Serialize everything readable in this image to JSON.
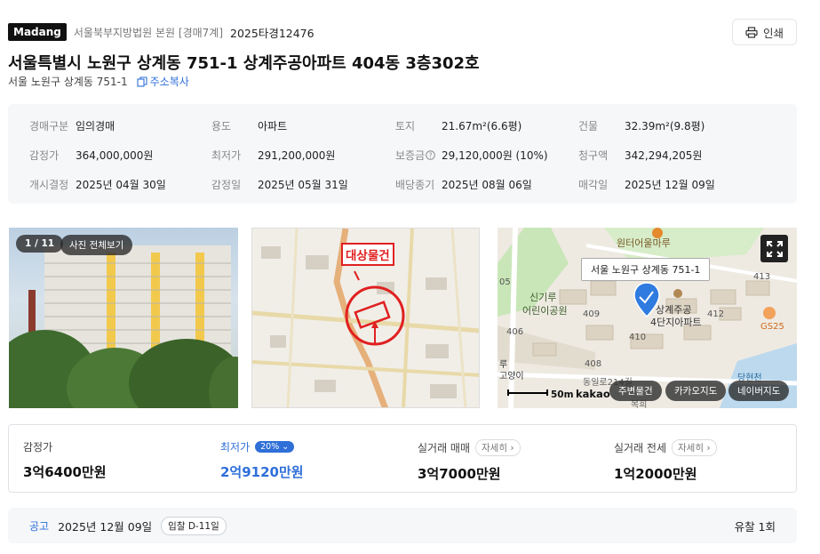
{
  "header": {
    "brand": "Madang",
    "court": "서울북부지방법원 본원 [경매7계]",
    "case_number": "2025타경12476",
    "print_label": "인쇄"
  },
  "property": {
    "title": "서울특별시 노원구 상계동 751-1 상계주공아파트 404동 3층302호",
    "address": "서울 노원구 상계동 751-1",
    "copy_label": "주소복사"
  },
  "info": [
    {
      "key": "경매구분",
      "value": "임의경매"
    },
    {
      "key": "용도",
      "value": "아파트"
    },
    {
      "key": "토지",
      "value": "21.67m²(6.6평)"
    },
    {
      "key": "건물",
      "value": "32.39m²(9.8평)"
    },
    {
      "key": "감정가",
      "value": "364,000,000원"
    },
    {
      "key": "최저가",
      "value": "291,200,000원"
    },
    {
      "key": "보증금",
      "value": "29,120,000원 (10%)"
    },
    {
      "key": "청구액",
      "value": "342,294,205원"
    },
    {
      "key": "개시결정",
      "value": "2025년 04월 30일"
    },
    {
      "key": "감정일",
      "value": "2025년 05월 31일"
    },
    {
      "key": "배당종기",
      "value": "2025년 08월 06일"
    },
    {
      "key": "매각일",
      "value": "2025년 12월 09일"
    }
  ],
  "photo": {
    "counter": "1 / 11",
    "view_all": "사진 전체보기"
  },
  "diagram": {
    "target_label": "대상물건"
  },
  "map": {
    "callout": "서울 노원구 상계동 751-1",
    "scale": "50m",
    "provider": "kakao",
    "buttons": [
      "주변물건",
      "카카오지도",
      "네이버지도"
    ],
    "labels": [
      "원터어울마루",
      "신기루",
      "어린이공원",
      "상계주공",
      "4단지아파트",
      "413",
      "412",
      "409",
      "410",
      "406",
      "408",
      "05",
      "GS25",
      "루",
      "고양이",
      "동일로214길",
      "당현천",
      "복희"
    ]
  },
  "stats": {
    "appraisal_label": "감정가",
    "appraisal_value": "3억6400만원",
    "minimum_label": "최저가",
    "minimum_badge": "20%",
    "minimum_value": "2억9120만원",
    "sale_label": "실거래 매매",
    "sale_more": "자세히",
    "sale_value": "3억7000만원",
    "lease_label": "실거래 전세",
    "lease_more": "자세히",
    "lease_value": "1억2000만원"
  },
  "schedule": {
    "label": "공고",
    "date": "2025년 12월 09일",
    "dday": "입찰 D-11일",
    "fail_count": "유찰 1회"
  },
  "colors": {
    "accent": "#2f6fd8",
    "info_bg": "#f5f7f9",
    "target_red": "#e02020"
  }
}
